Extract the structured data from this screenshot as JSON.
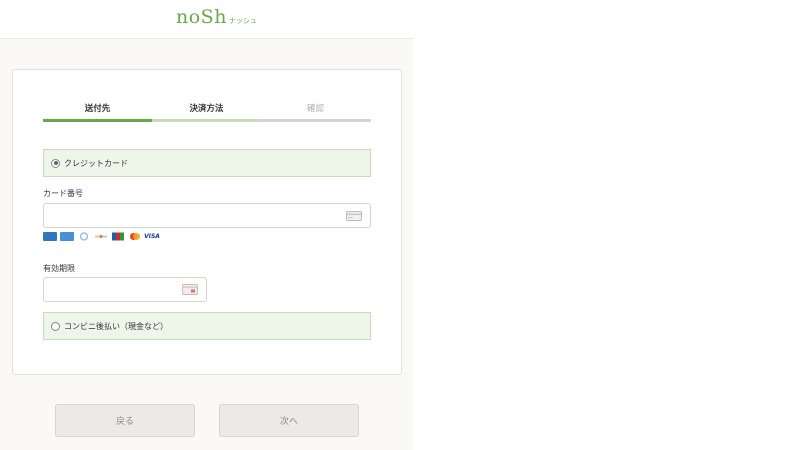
{
  "brand": {
    "logo": "noSh",
    "logo_sub": "ナッシュ",
    "accent": "#6aa844"
  },
  "steps": [
    {
      "label": "送付先",
      "state": "done"
    },
    {
      "label": "決済方法",
      "state": "current"
    },
    {
      "label": "確認",
      "state": "pending"
    }
  ],
  "payment": {
    "credit_card_label": "クレジットカード",
    "card_number_label": "カード番号",
    "card_number_value": "",
    "card_number_icon": "credit-card-icon",
    "card_brands": [
      {
        "name": "American Express",
        "short": "AMEX",
        "color": "#2e77bc"
      },
      {
        "name": "American Express",
        "short": "AE",
        "color": "#4a8fd4"
      },
      {
        "name": "Diners Club",
        "short": "DC",
        "color": "#8fb3d9"
      },
      {
        "name": "Discover",
        "short": "DISC",
        "color": "#e07b22"
      },
      {
        "name": "JCB",
        "short": "JCB",
        "color": "#1f5fa8"
      },
      {
        "name": "Mastercard",
        "short": "MC",
        "color": "#eb3b2c"
      },
      {
        "name": "VISA",
        "short": "VISA",
        "color": "#1a3a9e"
      }
    ],
    "expiry_label": "有効期限",
    "expiry_value": "",
    "expiry_icon": "calendar-card-icon",
    "convenience_label": "コンビニ後払い（現金など）"
  },
  "buttons": {
    "back": "戻る",
    "next": "次へ"
  }
}
